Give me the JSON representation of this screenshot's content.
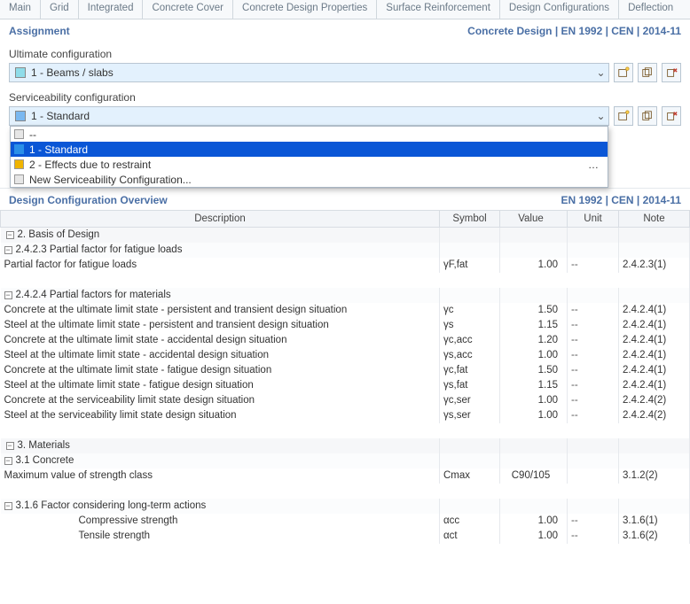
{
  "tabs": [
    "Main",
    "Grid",
    "Integrated",
    "Concrete Cover",
    "Concrete Design Properties",
    "Surface Reinforcement",
    "Design Configurations",
    "Deflection"
  ],
  "assignment": {
    "title": "Assignment",
    "subtitle": "Concrete Design | EN 1992 | CEN | 2014-11",
    "ultimate": {
      "label": "Ultimate configuration",
      "value": "1 - Beams / slabs",
      "swatch": "#8fdce9"
    },
    "serviceability": {
      "label": "Serviceability configuration",
      "value": "1 - Standard",
      "swatch": "#7ab8f0",
      "options": [
        {
          "label": "--",
          "swatch": "#e6e6e6"
        },
        {
          "label": "1 - Standard",
          "swatch": "#2a8fe8",
          "selected": true
        },
        {
          "label": "2 - Effects due to restraint",
          "swatch": "#f0b400",
          "ellipsis": true
        },
        {
          "label": "New Serviceability Configuration...",
          "swatch": "#e6e6e6"
        }
      ]
    },
    "buttons": {
      "new": "New",
      "dup": "Duplicate",
      "del": "Delete"
    }
  },
  "overview": {
    "title": "Design Configuration Overview",
    "subtitle": "EN 1992 | CEN | 2014-11",
    "columns": {
      "desc": "Description",
      "sym": "Symbol",
      "val": "Value",
      "unit": "Unit",
      "note": "Note"
    },
    "rows": [
      {
        "t": "group",
        "desc": "2. Basis of Design"
      },
      {
        "t": "subgroup",
        "desc": "2.4.2.3 Partial factor for fatigue loads"
      },
      {
        "t": "data",
        "desc": "Partial factor for fatigue loads",
        "sym": "γF,fat",
        "val": "1.00",
        "unit": "--",
        "note": "2.4.2.3(1)"
      },
      {
        "t": "blank"
      },
      {
        "t": "subgroup",
        "desc": "2.4.2.4 Partial factors for materials"
      },
      {
        "t": "data",
        "desc": "Concrete at the ultimate limit state - persistent and transient design situation",
        "sym": "γc",
        "val": "1.50",
        "unit": "--",
        "note": "2.4.2.4(1)"
      },
      {
        "t": "data",
        "desc": "Steel at the ultimate limit state - persistent and transient design situation",
        "sym": "γs",
        "val": "1.15",
        "unit": "--",
        "note": "2.4.2.4(1)"
      },
      {
        "t": "data",
        "desc": "Concrete at the ultimate limit state - accidental design situation",
        "sym": "γc,acc",
        "val": "1.20",
        "unit": "--",
        "note": "2.4.2.4(1)"
      },
      {
        "t": "data",
        "desc": "Steel at the ultimate limit state - accidental design situation",
        "sym": "γs,acc",
        "val": "1.00",
        "unit": "--",
        "note": "2.4.2.4(1)"
      },
      {
        "t": "data",
        "desc": "Concrete at the ultimate limit state - fatigue design situation",
        "sym": "γc,fat",
        "val": "1.50",
        "unit": "--",
        "note": "2.4.2.4(1)"
      },
      {
        "t": "data",
        "desc": "Steel at the ultimate limit state - fatigue design situation",
        "sym": "γs,fat",
        "val": "1.15",
        "unit": "--",
        "note": "2.4.2.4(1)"
      },
      {
        "t": "data",
        "desc": "Concrete at the serviceability limit state design situation",
        "sym": "γc,ser",
        "val": "1.00",
        "unit": "--",
        "note": "2.4.2.4(2)"
      },
      {
        "t": "data",
        "desc": "Steel at the serviceability limit state design situation",
        "sym": "γs,ser",
        "val": "1.00",
        "unit": "--",
        "note": "2.4.2.4(2)"
      },
      {
        "t": "blank"
      },
      {
        "t": "group",
        "desc": "3. Materials"
      },
      {
        "t": "subgroup",
        "desc": "3.1 Concrete"
      },
      {
        "t": "data",
        "desc": "Maximum value of strength class",
        "sym": "Cmax",
        "val": "C90/105",
        "unit": "",
        "note": "3.1.2(2)",
        "valalign": "center"
      },
      {
        "t": "blank"
      },
      {
        "t": "subgroup2",
        "desc": "3.1.6 Factor considering long-term actions"
      },
      {
        "t": "data2",
        "desc": "Compressive strength",
        "sym": "αcc",
        "val": "1.00",
        "unit": "--",
        "note": "3.1.6(1)"
      },
      {
        "t": "data2",
        "desc": "Tensile strength",
        "sym": "αct",
        "val": "1.00",
        "unit": "--",
        "note": "3.1.6(2)"
      }
    ]
  },
  "colors": {
    "sw_blank": "#e6e6e6",
    "sw_sel": "#2a8fe8",
    "sw_yel": "#f0b400"
  }
}
